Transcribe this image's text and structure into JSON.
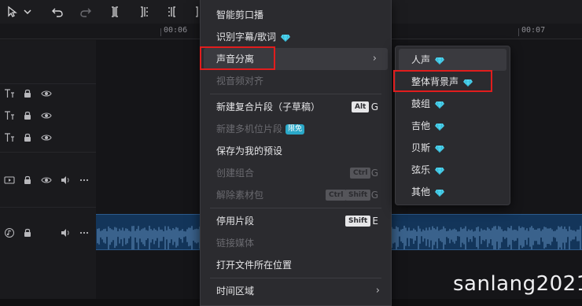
{
  "ruler": {
    "timecodes": [
      "00:06",
      "00:07"
    ]
  },
  "icons": {
    "select": "cursor-arrow-icon",
    "select_menu": "chevron-down-icon",
    "undo": "undo-icon",
    "redo": "redo-icon",
    "split": "split-icon",
    "split_left": "split-left-icon",
    "split_right": "split-right-icon",
    "delete": "delete-icon",
    "text_track": "text-icon",
    "lock": "lock-icon",
    "eye": "eye-icon",
    "video": "video-icon",
    "audio": "speaker-icon",
    "more": "more-icon",
    "music": "music-icon",
    "gem": "diamond-icon",
    "submenu": "chevron-right-icon"
  },
  "menu": {
    "items": [
      {
        "label": "智能剪口播"
      },
      {
        "label": "识别字幕/歌词"
      },
      {
        "label": "声音分离"
      },
      {
        "label": "视音频对齐"
      },
      {
        "label": "新建复合片段（子草稿）",
        "mod": "Alt",
        "key": "G"
      },
      {
        "label": "新建多机位片段",
        "badge": "限免"
      },
      {
        "label": "保存为我的预设"
      },
      {
        "label": "创建组合",
        "mod": "Ctrl",
        "key": "G"
      },
      {
        "label": "解除素材包",
        "mod1": "Ctrl",
        "mod2": "Shift",
        "key": "G"
      },
      {
        "label": "停用片段",
        "mod": "Shift",
        "key": "E"
      },
      {
        "label": "链接媒体"
      },
      {
        "label": "打开文件所在位置"
      },
      {
        "label": "时间区域"
      }
    ]
  },
  "submenu": {
    "items": [
      {
        "label": "人声"
      },
      {
        "label": "整体背景声"
      },
      {
        "label": "鼓组"
      },
      {
        "label": "吉他"
      },
      {
        "label": "贝斯"
      },
      {
        "label": "弦乐"
      },
      {
        "label": "其他"
      }
    ]
  },
  "watermark": "sanlang2021",
  "colors": {
    "highlight": "#e11d1d",
    "gem": "#4fd6f0",
    "free_badge": "#2aa8c8",
    "audio_clip": "#13355a",
    "waveform": "#6f9fcf"
  }
}
